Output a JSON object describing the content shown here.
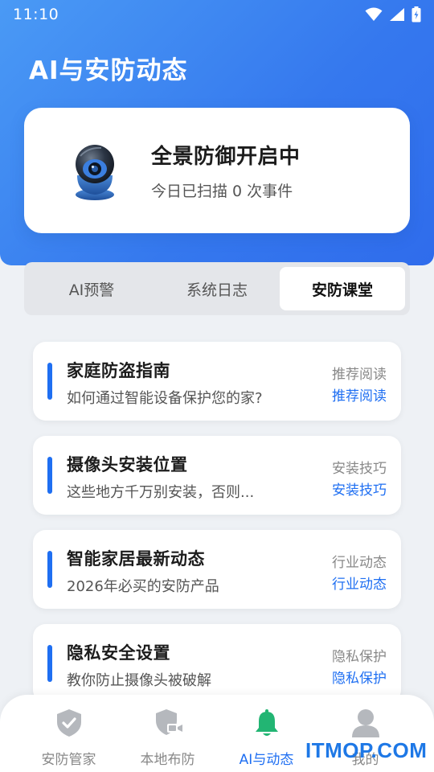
{
  "status_bar": {
    "time": "11:10",
    "icons": [
      "wifi-icon",
      "signal-icon",
      "battery-charging-icon"
    ]
  },
  "header": {
    "title": "AI与安防动态"
  },
  "protection_card": {
    "icon": "security-camera-icon",
    "status_title": "全景防御开启中",
    "status_subtitle": "今日已扫描 0 次事件"
  },
  "tabs": [
    {
      "label": "AI预警",
      "active": false
    },
    {
      "label": "系统日志",
      "active": false
    },
    {
      "label": "安防课堂",
      "active": true
    }
  ],
  "articles": [
    {
      "title": "家庭防盗指南",
      "desc": "如何通过智能设备保护您的家?",
      "tag": "推荐阅读",
      "tag_link": "推荐阅读"
    },
    {
      "title": "摄像头安装位置",
      "desc": "这些地方千万别安装，否则...",
      "tag": "安装技巧",
      "tag_link": "安装技巧"
    },
    {
      "title": "智能家居最新动态",
      "desc": "2026年必买的安防产品",
      "tag": "行业动态",
      "tag_link": "行业动态"
    },
    {
      "title": "隐私安全设置",
      "desc": "教你防止摄像头被破解",
      "tag": "隐私保护",
      "tag_link": "隐私保护"
    }
  ],
  "bottom_nav": [
    {
      "label": "安防管家",
      "icon": "shield-check-icon",
      "active": false
    },
    {
      "label": "本地布防",
      "icon": "shield-camera-icon",
      "active": false
    },
    {
      "label": "AI与动态",
      "icon": "bell-icon",
      "active": true
    },
    {
      "label": "我的",
      "icon": "user-icon",
      "active": false
    }
  ],
  "watermark": "ITMOP.COM",
  "colors": {
    "accent": "#1f6ff2",
    "header_gradient_start": "#4a9af5",
    "header_gradient_end": "#2f6cec",
    "nav_inactive": "#b5b8bd"
  }
}
